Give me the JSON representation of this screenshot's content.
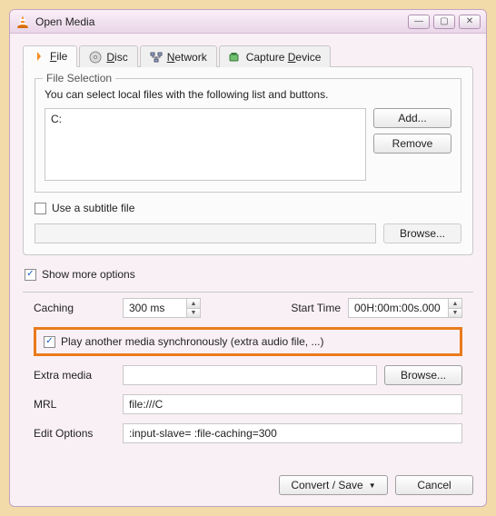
{
  "window": {
    "title": "Open Media"
  },
  "tabs": {
    "file": "File",
    "file_key": "F",
    "disc": "Disc",
    "disc_key": "D",
    "network": "Network",
    "network_key": "N",
    "capture": "Capture Device",
    "capture_key": "D"
  },
  "file_selection": {
    "legend": "File Selection",
    "hint": "You can select local files with the following list and buttons.",
    "items": [
      "C:"
    ],
    "add": "Add...",
    "remove": "Remove"
  },
  "subtitle": {
    "label": "Use a subtitle file",
    "checked": false,
    "browse": "Browse...",
    "value": ""
  },
  "show_more": {
    "label": "Show more options",
    "checked": true
  },
  "opts": {
    "caching_label": "Caching",
    "caching_value": "300 ms",
    "start_label": "Start Time",
    "start_value": "00H:00m:00s.000",
    "sync_label": "Play another media synchronously (extra audio file, ...)",
    "sync_checked": true,
    "extra_label": "Extra media",
    "extra_value": "",
    "browse": "Browse...",
    "mrl_label": "MRL",
    "mrl_value": "file:///C",
    "edit_label": "Edit Options",
    "edit_value": ":input-slave= :file-caching=300"
  },
  "footer": {
    "convert": "Convert / Save",
    "cancel": "Cancel"
  }
}
